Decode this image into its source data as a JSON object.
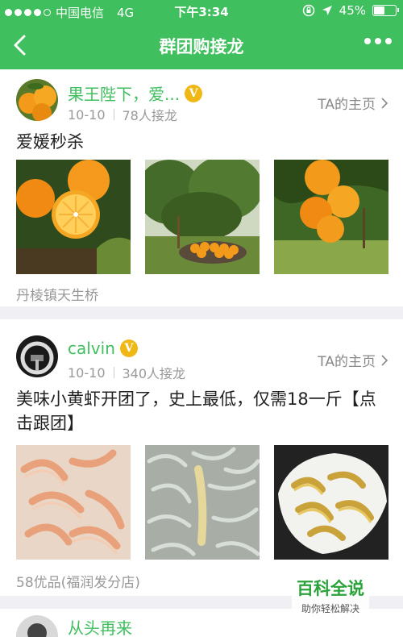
{
  "status": {
    "carrier": "中国电信",
    "network": "4G",
    "time": "下午3:34",
    "battery": "45%",
    "battery_level": 0.45
  },
  "nav": {
    "title": "群团购接龙"
  },
  "posts": [
    {
      "name": "果王陛下，爱...",
      "badge": "V",
      "date": "10-10",
      "count": "78人接龙",
      "home_link": "TA的主页",
      "title": "爱媛秒杀",
      "location": "丹棱镇天生桥"
    },
    {
      "name": "calvin",
      "badge": "V",
      "date": "10-10",
      "count": "340人接龙",
      "home_link": "TA的主页",
      "title": "美味小黄虾开团了，史上最低，仅需18一斤【点击跟团】",
      "location": "58优品(福润发分店)"
    },
    {
      "name": "从头再来"
    }
  ],
  "watermark": {
    "title": "百科全说",
    "subtitle": "助你轻松解决"
  },
  "colors": {
    "brand_green": "#3fbf5e",
    "badge_gold": "#f0b814"
  }
}
